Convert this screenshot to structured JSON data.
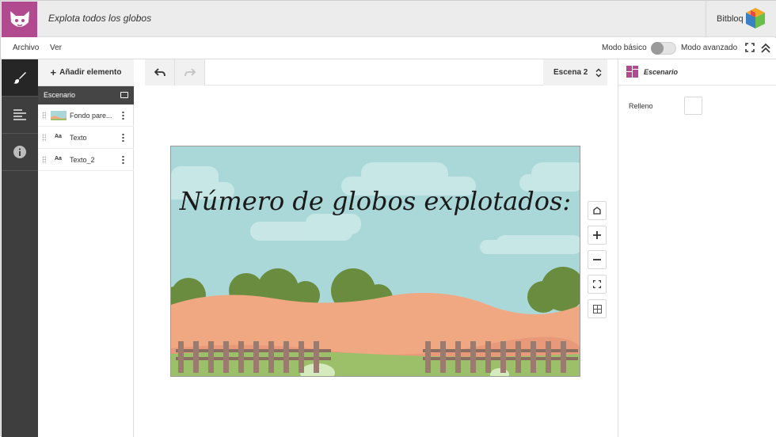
{
  "header": {
    "doc_title": "Explota todos los globos",
    "brand": "Bitbloq"
  },
  "menu": {
    "file": "Archivo",
    "view": "Ver",
    "basic_mode": "Modo básico",
    "advanced_mode": "Modo avanzado"
  },
  "rail": {
    "items": [
      "paint-brush-icon",
      "align-left-icon",
      "info-icon"
    ]
  },
  "elements_panel": {
    "add_label": "Añadir elemento",
    "scene_header": "Escenario",
    "items": [
      {
        "label": "Fondo pare...",
        "icon": "image-thumbnail"
      },
      {
        "label": "Texto",
        "icon": "text-aa-icon",
        "icon_text": "Aa"
      },
      {
        "label": "Texto_2",
        "icon": "text-aa-icon",
        "icon_text": "Aa"
      }
    ]
  },
  "toolbar": {
    "scene_name": "Escena 2"
  },
  "stage": {
    "text": "Número de globos explotados:",
    "colors": {
      "sky": "#aad8d8",
      "hills": "#f0a882",
      "bushes": "#6a8c3e",
      "grass": "#9cc06a",
      "fence": "#8a6e62"
    }
  },
  "properties": {
    "title": "Escenario",
    "fill_label": "Relleno",
    "fill_color": "#ffffff"
  },
  "colors": {
    "accent": "#b24a8f"
  }
}
